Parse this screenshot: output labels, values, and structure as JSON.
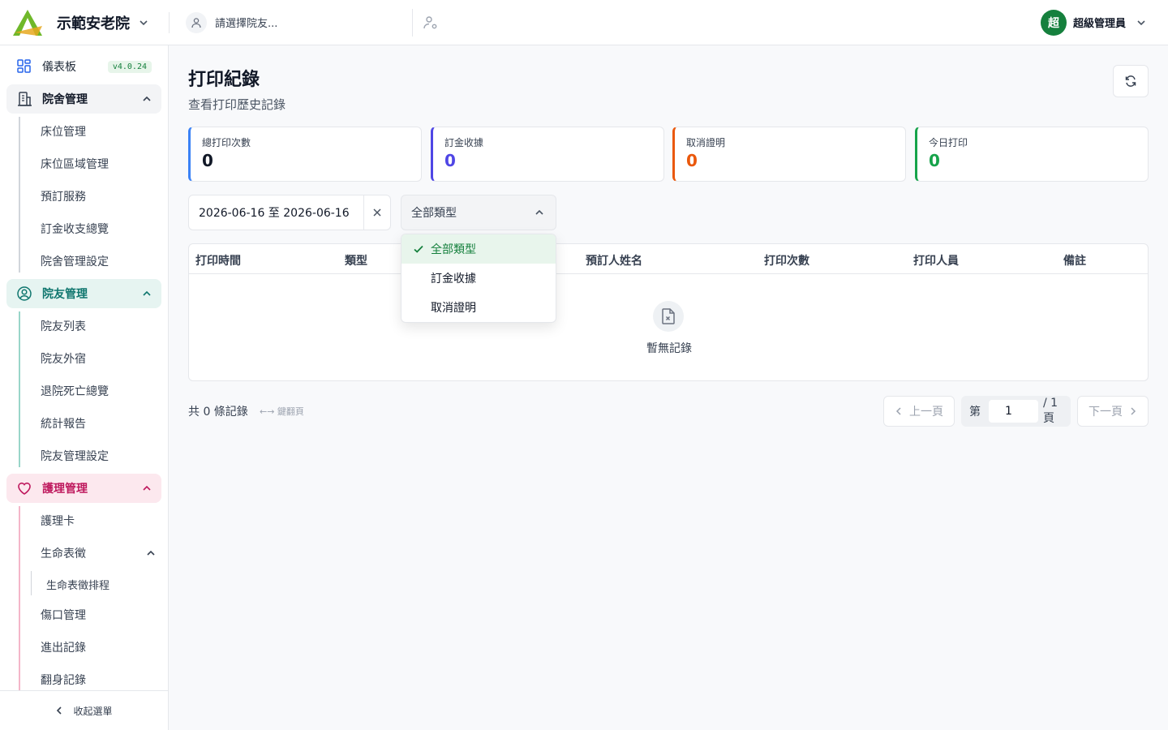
{
  "header": {
    "org_name": "示範安老院",
    "resident_placeholder": "請選擇院友...",
    "user_initial": "超",
    "user_name": "超級管理員"
  },
  "sidebar": {
    "version": "v4.0.24",
    "dashboard": "儀表板",
    "groups": [
      {
        "label": "院舍管理",
        "items": [
          "床位管理",
          "床位區域管理",
          "預訂服務",
          "訂金收支總覽",
          "院舍管理設定"
        ]
      },
      {
        "label": "院友管理",
        "items": [
          "院友列表",
          "院友外宿",
          "退院死亡總覽",
          "統計報告",
          "院友管理設定"
        ]
      },
      {
        "label": "護理管理",
        "items": [
          "護理卡",
          "生命表徵",
          "傷口管理",
          "進出記錄",
          "翻身記錄"
        ],
        "subitem": "生命表徵排程"
      }
    ],
    "collapse_label": "收起選單"
  },
  "page": {
    "title": "打印紀錄",
    "subtitle": "查看打印歷史記錄"
  },
  "stats": [
    {
      "label": "總打印次數",
      "value": "0",
      "color": "#3b82f6",
      "value_color": "#111827"
    },
    {
      "label": "訂金收據",
      "value": "0",
      "color": "#4f46e5",
      "value_color": "#4f46e5"
    },
    {
      "label": "取消證明",
      "value": "0",
      "color": "#ea580c",
      "value_color": "#ea580c"
    },
    {
      "label": "今日打印",
      "value": "0",
      "color": "#16a34a",
      "value_color": "#16a34a"
    }
  ],
  "filters": {
    "date_range": "2026-06-16 至 2026-06-16",
    "type_selected": "全部類型",
    "type_options": [
      "全部類型",
      "訂金收據",
      "取消證明"
    ]
  },
  "table": {
    "columns": [
      "打印時間",
      "類型",
      "預訂人姓名",
      "打印次數",
      "打印人員",
      "備註"
    ],
    "empty_text": "暫無記錄"
  },
  "footer": {
    "total": "共 0 條記錄",
    "hint": "←→ 鍵翻頁",
    "prev": "上一頁",
    "next": "下一頁",
    "page_prefix": "第",
    "page_value": "1",
    "page_suffix": "/ 1 頁"
  },
  "colors": {
    "brand_green": "#15803d",
    "resident_teal": "#0f766e",
    "nursing_pink": "#be185d"
  }
}
